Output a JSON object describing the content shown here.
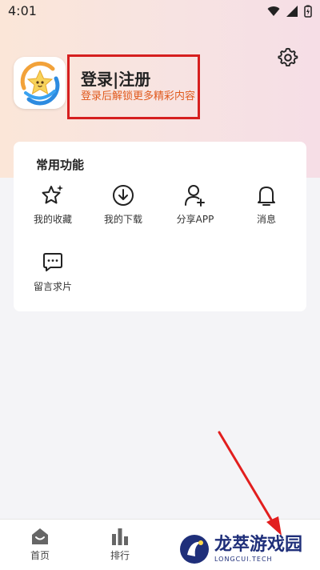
{
  "status_bar": {
    "time": "4:01"
  },
  "profile": {
    "title": "登录|注册",
    "subtitle": "登录后解锁更多精彩内容"
  },
  "functions": {
    "section_title": "常用功能",
    "items": [
      {
        "label": "我的收藏",
        "icon": "star-sparkle-icon"
      },
      {
        "label": "我的下载",
        "icon": "download-icon"
      },
      {
        "label": "分享APP",
        "icon": "share-user-icon"
      },
      {
        "label": "消息",
        "icon": "bell-icon"
      },
      {
        "label": "留言求片",
        "icon": "message-icon"
      }
    ]
  },
  "tabbar": {
    "items": [
      {
        "label": "首页",
        "icon": "home-icon"
      },
      {
        "label": "排行",
        "icon": "ranking-icon"
      }
    ]
  },
  "watermark": {
    "main": "龙萃游戏园",
    "sub": "LONGCUI.TECH"
  },
  "colors": {
    "highlight_box": "#d61f1f",
    "arrow": "#e21e1e",
    "subtitle": "#e05a1e"
  }
}
